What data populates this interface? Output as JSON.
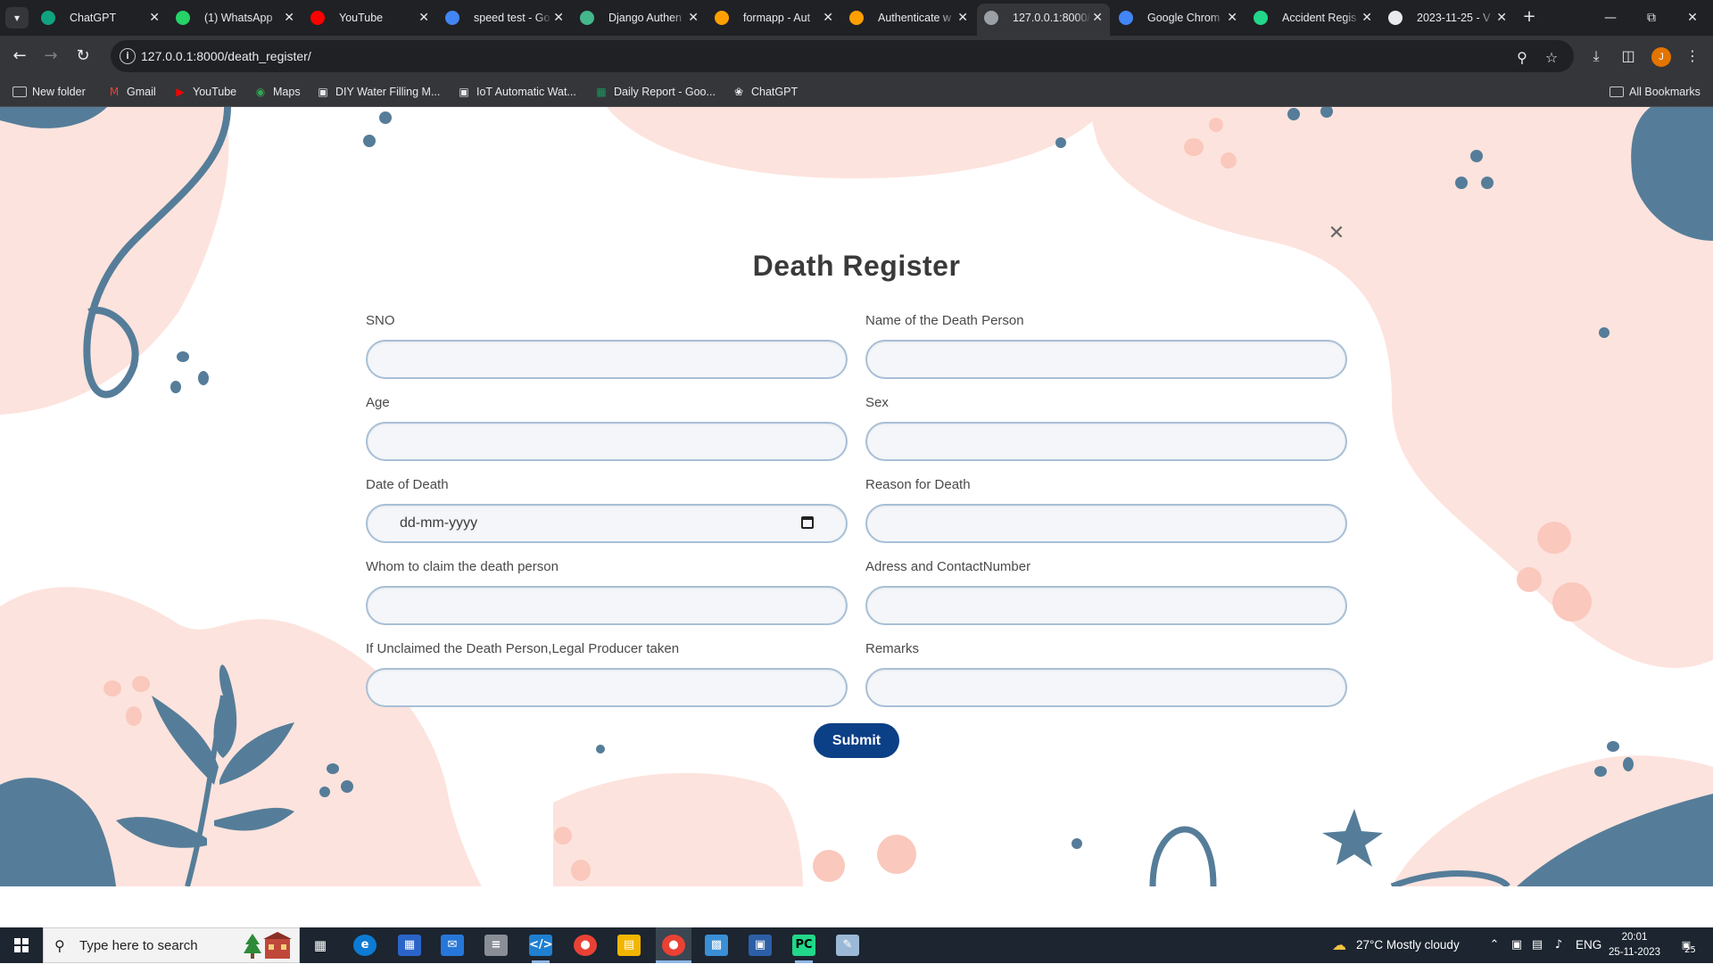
{
  "browser": {
    "tabs": [
      {
        "title": "ChatGPT",
        "icon": "chatgpt-icon",
        "color": "#10a37f"
      },
      {
        "title": "(1) WhatsApp",
        "icon": "whatsapp-icon",
        "color": "#25d366"
      },
      {
        "title": "YouTube",
        "icon": "youtube-icon",
        "color": "#ff0000"
      },
      {
        "title": "speed test - Go",
        "icon": "google-icon",
        "color": "#4285f4"
      },
      {
        "title": "Django Authen",
        "icon": "django-icon",
        "color": "#44b78b"
      },
      {
        "title": "formapp - Aut",
        "icon": "firebase-icon",
        "color": "#ffa000"
      },
      {
        "title": "Authenticate w",
        "icon": "firebase-icon",
        "color": "#ffa000"
      },
      {
        "title": "127.0.0.1:8000/",
        "icon": "globe-icon",
        "color": "#9aa0a6"
      },
      {
        "title": "Google Chrom",
        "icon": "google-icon",
        "color": "#4285f4"
      },
      {
        "title": "Accident Regis",
        "icon": "pycharm-icon",
        "color": "#21d789"
      },
      {
        "title": "2023-11-25 - V",
        "icon": "github-icon",
        "color": "#e8eaed"
      }
    ],
    "active_tab_index": 7,
    "url": "127.0.0.1:8000/death_register/",
    "profile_initial": "J",
    "bookmarks": [
      {
        "label": "New folder",
        "icon": "folder-icon"
      },
      {
        "label": "Gmail",
        "icon": "gmail-icon"
      },
      {
        "label": "YouTube",
        "icon": "youtube-icon"
      },
      {
        "label": "Maps",
        "icon": "maps-icon"
      },
      {
        "label": "DIY Water Filling M...",
        "icon": "bookmark-page-icon"
      },
      {
        "label": "IoT Automatic Wat...",
        "icon": "bookmark-page-icon"
      },
      {
        "label": "Daily Report - Goo...",
        "icon": "sheets-icon"
      },
      {
        "label": "ChatGPT",
        "icon": "chatgpt-icon"
      }
    ],
    "all_bookmarks_label": "All Bookmarks"
  },
  "form": {
    "title": "Death Register",
    "close_icon": "close-icon",
    "fields": {
      "sno": {
        "label": "SNO",
        "value": ""
      },
      "name": {
        "label": "Name of the Death Person",
        "value": ""
      },
      "age": {
        "label": "Age",
        "value": ""
      },
      "sex": {
        "label": "Sex",
        "value": ""
      },
      "date_of_death": {
        "label": "Date of Death",
        "placeholder": "dd-mm-yyyy"
      },
      "reason": {
        "label": "Reason for Death",
        "value": ""
      },
      "claimant": {
        "label": "Whom to claim the death person",
        "value": ""
      },
      "address_contact": {
        "label": "Adress and ContactNumber",
        "value": ""
      },
      "unclaimed_procedure": {
        "label": "If Unclaimed the Death Person,Legal Producer taken",
        "value": ""
      },
      "remarks": {
        "label": "Remarks",
        "value": ""
      }
    },
    "submit_label": "Submit",
    "colors": {
      "accent": "#0b3f86",
      "decor_blue": "#557d99",
      "decor_pink": "#fde3dd"
    }
  },
  "taskbar": {
    "search_placeholder": "Type here to search",
    "weather": "27°C  Mostly cloudy",
    "language": "ENG",
    "time": "20:01",
    "date": "25-11-2023",
    "notification_count": "25"
  }
}
